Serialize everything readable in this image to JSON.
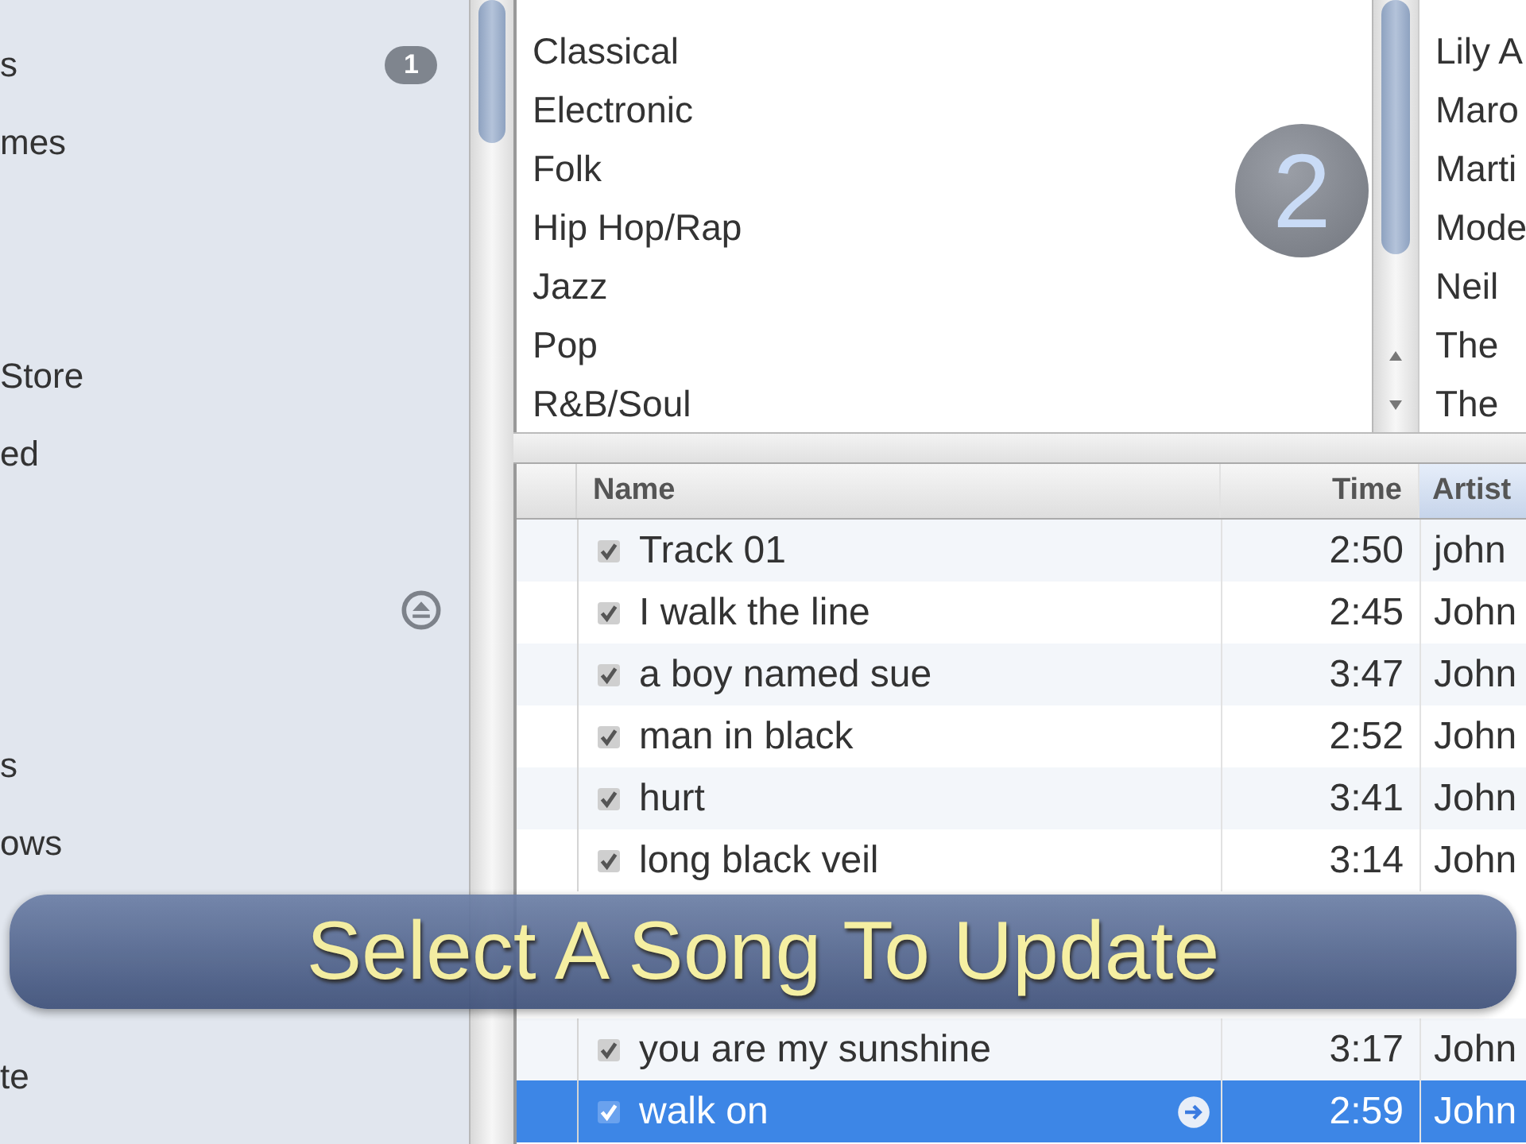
{
  "sidebar": {
    "sections": [
      {
        "items": [
          {
            "kind": "label",
            "label": "s",
            "badge": "1"
          },
          {
            "kind": "label",
            "label": "mes"
          }
        ]
      },
      {
        "items": [
          {
            "kind": "label",
            "label": "Store"
          },
          {
            "kind": "label",
            "label": "ed"
          }
        ]
      },
      {
        "items": [
          {
            "kind": "eject"
          }
        ]
      },
      {
        "items": [
          {
            "kind": "label",
            "label": "s"
          },
          {
            "kind": "label",
            "label": "ows"
          }
        ]
      },
      {
        "items": [
          {
            "kind": "label",
            "label": "te"
          }
        ]
      }
    ]
  },
  "genres": [
    "Classical",
    "Electronic",
    "Folk",
    "Hip Hop/Rap",
    "Jazz",
    "Pop",
    "R&B/Soul"
  ],
  "step_badge": "2",
  "artists": [
    "Lily A",
    "Maro",
    "Marti",
    "Mode",
    "Neil",
    "The",
    "The"
  ],
  "table": {
    "columns": [
      "Name",
      "Time",
      "Artist"
    ],
    "rows_above": [
      {
        "name": "Track 01",
        "time": "2:50",
        "artist": "john",
        "checked": true,
        "selected": false
      },
      {
        "name": "I walk the line",
        "time": "2:45",
        "artist": "John",
        "checked": true,
        "selected": false
      },
      {
        "name": "a boy named sue",
        "time": "3:47",
        "artist": "John",
        "checked": true,
        "selected": false
      },
      {
        "name": "man in black",
        "time": "2:52",
        "artist": "John",
        "checked": true,
        "selected": false
      },
      {
        "name": "hurt",
        "time": "3:41",
        "artist": "John",
        "checked": true,
        "selected": false
      },
      {
        "name": "long black veil",
        "time": "3:14",
        "artist": "John",
        "checked": true,
        "selected": false
      }
    ],
    "rows_below": [
      {
        "name": "you are my sunshine",
        "time": "3:17",
        "artist": "John",
        "checked": true,
        "selected": false
      },
      {
        "name": "walk on",
        "time": "2:59",
        "artist": "John",
        "checked": true,
        "selected": true
      }
    ]
  },
  "caption": "Select A Song To Update"
}
